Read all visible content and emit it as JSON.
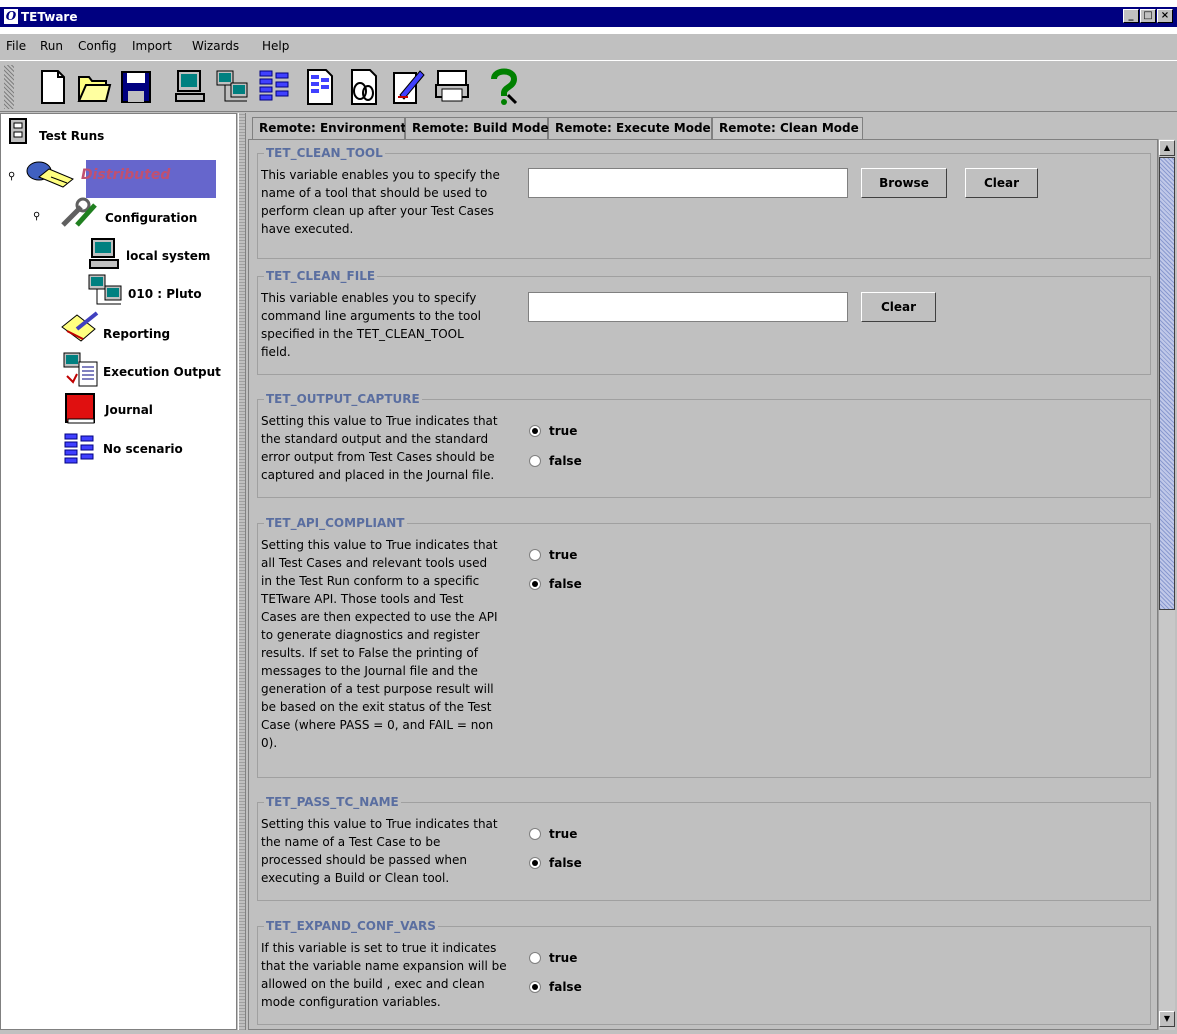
{
  "window": {
    "title": "TETware"
  },
  "menu": [
    "File",
    "Run",
    "Config",
    "Import",
    "Wizards",
    "Help"
  ],
  "toolbar": {
    "icons": [
      "new-file-icon",
      "open-folder-icon",
      "save-icon",
      "local-system-icon",
      "remote-system-icon",
      "scenario-icon",
      "scenario-file-icon",
      "journal-report-icon",
      "edit-report-icon",
      "print-icon",
      "help-icon"
    ]
  },
  "tree": {
    "root": "Test Runs",
    "distributed": "Distributed",
    "configuration": "Configuration",
    "local": "local system",
    "remote": "010 : Pluto",
    "reporting": "Reporting",
    "execution_output": "Execution Output",
    "journal": "Journal",
    "scenario": "No scenario"
  },
  "tabs": [
    {
      "label": "Remote: Environment"
    },
    {
      "label": "Remote: Build Mode"
    },
    {
      "label": "Remote: Execute Mode"
    },
    {
      "label": "Remote: Clean Mode",
      "active": true
    }
  ],
  "sections": {
    "clean_tool": {
      "title": "TET_CLEAN_TOOL",
      "description": "This variable enables you to specify the\nname of a tool that should be used to\nperform clean up after your Test Cases\nhave executed.",
      "value": "",
      "browse": "Browse",
      "clear": "Clear"
    },
    "clean_file": {
      "title": "TET_CLEAN_FILE",
      "description": "This variable enables you to specify\ncommand line arguments to the tool\nspecified in the TET_CLEAN_TOOL\nfield.",
      "value": "",
      "clear": "Clear"
    },
    "output_capture": {
      "title": "TET_OUTPUT_CAPTURE",
      "description": "Setting this value to True indicates that\nthe standard output and the standard\nerror output from Test Cases should be\ncaptured and placed in the Journal file.",
      "true_label": "true",
      "false_label": "false",
      "selected": "true"
    },
    "api_compliant": {
      "title": "TET_API_COMPLIANT",
      "description": "Setting this value to True indicates that\nall Test Cases and relevant tools used\nin the Test Run conform to a specific\nTETware API.  Those tools and Test\nCases are then expected to use the API\nto generate diagnostics and register\nresults.  If set to False the printing of\nmessages to the Journal file and the\ngeneration of a test purpose result will\nbe based on the exit status of the Test\nCase (where PASS = 0, and FAIL = non\n0).",
      "true_label": "true",
      "false_label": "false",
      "selected": "false"
    },
    "pass_tc_name": {
      "title": "TET_PASS_TC_NAME",
      "description": "Setting this value to True indicates that\nthe name of a Test Case to be\nprocessed should be passed when\nexecuting a Build or Clean tool.",
      "true_label": "true",
      "false_label": "false",
      "selected": "false"
    },
    "expand_conf_vars": {
      "title": "TET_EXPAND_CONF_VARS",
      "description": "If this variable is set to true it indicates\nthat the variable name expansion will be\nallowed on the build , exec and clean\nmode configuration variables.",
      "true_label": "true",
      "false_label": "false",
      "selected": "false"
    }
  }
}
